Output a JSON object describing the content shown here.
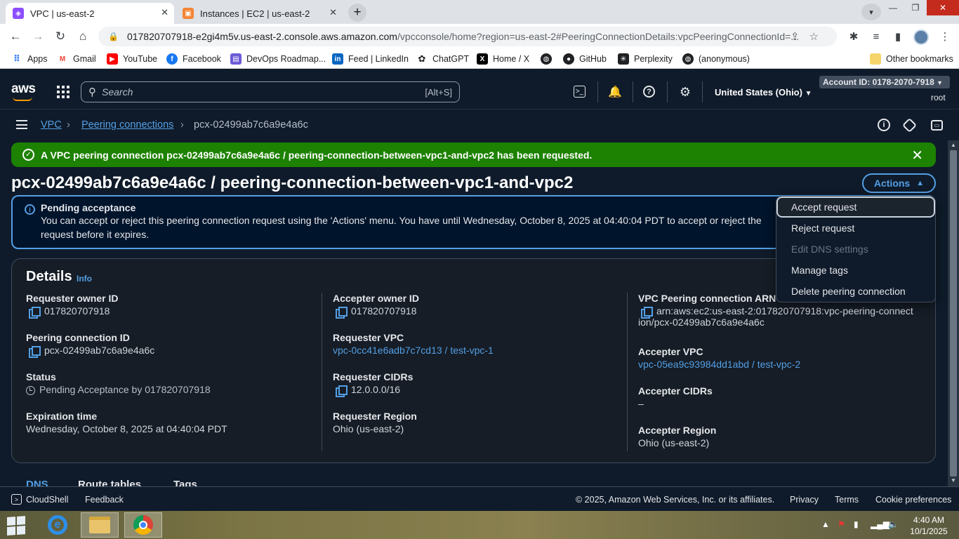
{
  "browser": {
    "tabs": [
      {
        "title": "VPC | us-east-2",
        "active": true
      },
      {
        "title": "Instances | EC2 | us-east-2",
        "active": false
      }
    ],
    "url_main": "017820707918-e2gi4m5v.us-east-2.console.aws.amazon.com",
    "url_rest": "/vpcconsole/home?region=us-east-2#PeeringConnectionDetails:vpcPeeringConnectionId=...",
    "bookmarks": [
      "Apps",
      "Gmail",
      "YouTube",
      "Facebook",
      "DevOps Roadmap...",
      "Feed | LinkedIn",
      "ChatGPT",
      "Home / X",
      "GitHub",
      "Perplexity",
      "(anonymous)"
    ],
    "other_bookmarks": "Other bookmarks"
  },
  "aws": {
    "logo": "aws",
    "search_placeholder": "Search",
    "search_shortcut": "[Alt+S]",
    "region": "United States (Ohio)",
    "account": "Account ID: 0178-2070-7918",
    "user": "root"
  },
  "breadcrumb": {
    "root": "VPC",
    "section": "Peering connections",
    "current": "pcx-02499ab7c6a9e4a6c"
  },
  "flash": {
    "message": "A VPC peering connection pcx-02499ab7c6a9e4a6c / peering-connection-between-vpc1-and-vpc2 has been requested."
  },
  "page": {
    "title": "pcx-02499ab7c6a9e4a6c / peering-connection-between-vpc1-and-vpc2",
    "actions_label": "Actions"
  },
  "alert": {
    "heading": "Pending acceptance",
    "body": "You can accept or reject this peering connection request using the 'Actions' menu. You have until Wednesday, October 8, 2025 at 04:40:04 PDT to accept or reject the request before it expires."
  },
  "actions_menu": [
    {
      "label": "Accept request",
      "disabled": false
    },
    {
      "label": "Reject request",
      "disabled": false
    },
    {
      "label": "Edit DNS settings",
      "disabled": true
    },
    {
      "label": "Manage tags",
      "disabled": false
    },
    {
      "label": "Delete peering connection",
      "disabled": false
    }
  ],
  "details": {
    "heading": "Details",
    "info": "Info",
    "requester_owner_id": {
      "label": "Requester owner ID",
      "value": "017820707918"
    },
    "peering_connection_id": {
      "label": "Peering connection ID",
      "value": "pcx-02499ab7c6a9e4a6c"
    },
    "status": {
      "label": "Status",
      "value": "Pending Acceptance by 017820707918"
    },
    "expiration_time": {
      "label": "Expiration time",
      "value": "Wednesday, October 8, 2025 at 04:40:04 PDT"
    },
    "accepter_owner_id": {
      "label": "Accepter owner ID",
      "value": "017820707918"
    },
    "requester_vpc": {
      "label": "Requester VPC",
      "value": "vpc-0cc41e6adb7c7cd13 / test-vpc-1"
    },
    "requester_cidrs": {
      "label": "Requester CIDRs",
      "value": "12.0.0.0/16"
    },
    "requester_region": {
      "label": "Requester Region",
      "value": "Ohio (us-east-2)"
    },
    "arn": {
      "label": "VPC Peering connection ARN",
      "line1": "arn:aws:ec2:us-east-2:017820707918:vpc-peering-connect",
      "line2": "ion/pcx-02499ab7c6a9e4a6c"
    },
    "accepter_vpc": {
      "label": "Accepter VPC",
      "value": "vpc-05ea9c93984dd1abd / test-vpc-2"
    },
    "accepter_cidrs": {
      "label": "Accepter CIDRs",
      "value": "–"
    },
    "accepter_region": {
      "label": "Accepter Region",
      "value": "Ohio (us-east-2)"
    }
  },
  "bottom_tabs": [
    "DNS",
    "Route tables",
    "Tags"
  ],
  "footer": {
    "cloudshell": "CloudShell",
    "feedback": "Feedback",
    "copyright": "© 2025, Amazon Web Services, Inc. or its affiliates.",
    "privacy": "Privacy",
    "terms": "Terms",
    "cookies": "Cookie preferences"
  },
  "taskbar": {
    "time": "4:40 AM",
    "date": "10/1/2025"
  }
}
